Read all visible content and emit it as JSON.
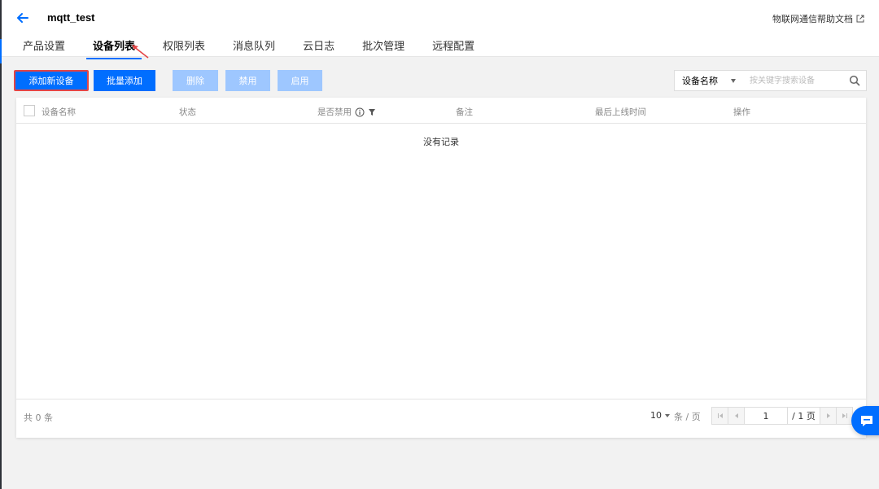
{
  "header": {
    "title": "mqtt_test",
    "help_link": "物联网通信帮助文档"
  },
  "tabs": [
    "产品设置",
    "设备列表",
    "权限列表",
    "消息队列",
    "云日志",
    "批次管理",
    "远程配置"
  ],
  "active_tab": "设备列表",
  "toolbar": {
    "add_device": "添加新设备",
    "batch_add": "批量添加",
    "delete": "删除",
    "disable": "禁用",
    "enable": "启用"
  },
  "filter": {
    "selected": "设备名称",
    "placeholder": "按关键字搜索设备"
  },
  "table": {
    "columns": [
      "设备名称",
      "状态",
      "是否禁用",
      "备注",
      "最后上线时间",
      "操作"
    ],
    "rows": [],
    "empty_text": "没有记录"
  },
  "pagination": {
    "total_label": "共 0 条",
    "page_size": "10",
    "per_page_label": "条 / 页",
    "current_page": "1",
    "page_total_label": "/ 1 页"
  },
  "colors": {
    "primary": "#006eff",
    "primary_disabled": "#9ec7ff",
    "highlight_border": "#e54545"
  }
}
